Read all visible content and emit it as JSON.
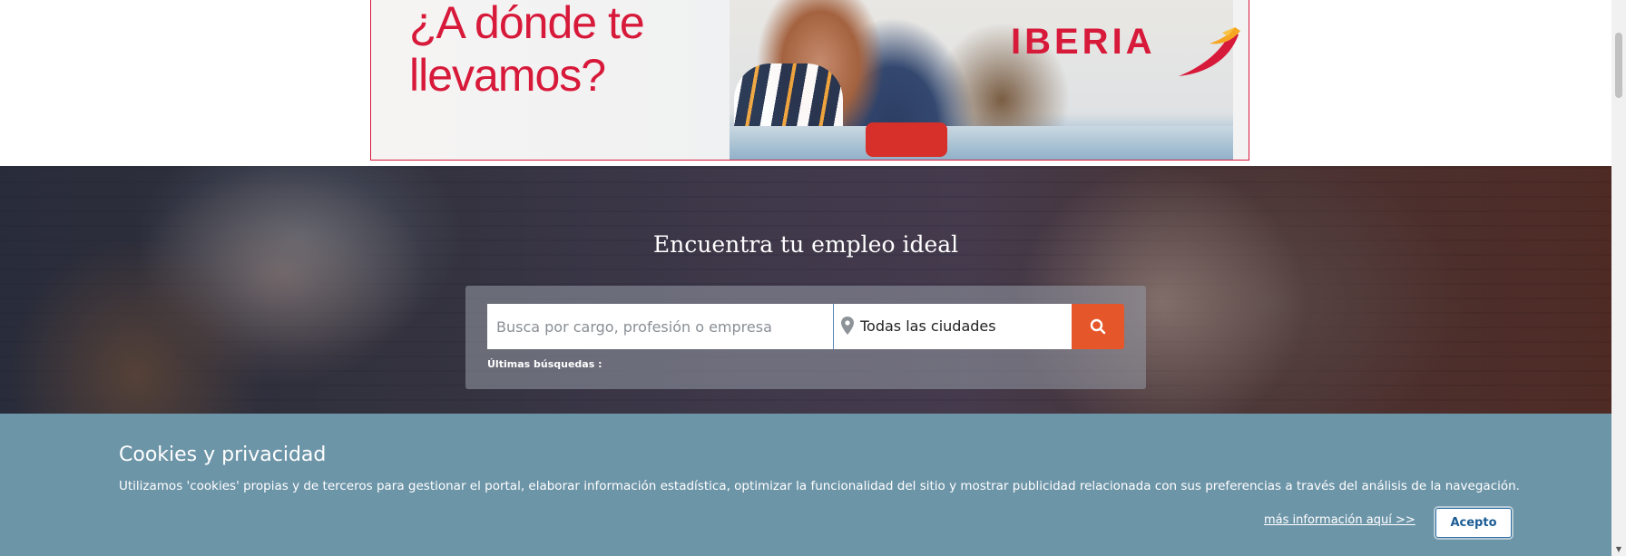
{
  "ad": {
    "headline": "¿A dónde te\nllevamos?",
    "brand": "IBERIA",
    "brand_color": "#d7193a"
  },
  "hero": {
    "title": "Encuentra tu empleo ideal",
    "search": {
      "placeholder": "Busca por cargo, profesión o empresa",
      "value": "",
      "city_value": "Todas las ciudades",
      "button_icon": "search-icon",
      "button_color": "#e5562a"
    },
    "recent_label": "Últimas búsquedas :"
  },
  "cookies": {
    "title": "Cookies y privacidad",
    "text": "Utilizamos 'cookies' propias y de terceros para gestionar el portal, elaborar información estadística, optimizar la funcionalidad del sitio y mostrar publicidad relacionada con sus preferencias a través del análisis de la navegación.",
    "more_link": "más información aquí >>",
    "accept_label": "Acepto",
    "background": "#6d95a8"
  },
  "scrollbar": {
    "down_icon": "chevron-down-icon"
  }
}
